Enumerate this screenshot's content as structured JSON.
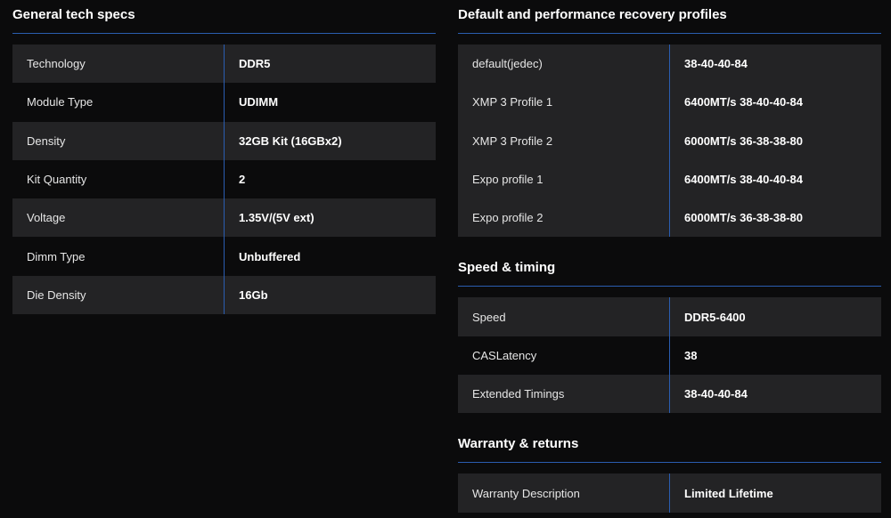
{
  "sections": {
    "general": {
      "title": "General tech specs",
      "rows": [
        {
          "label": "Technology",
          "value": "DDR5"
        },
        {
          "label": "Module Type",
          "value": "UDIMM"
        },
        {
          "label": "Density",
          "value": "32GB Kit (16GBx2)"
        },
        {
          "label": "Kit Quantity",
          "value": "2"
        },
        {
          "label": "Voltage",
          "value": "1.35V/(5V ext)"
        },
        {
          "label": "Dimm Type",
          "value": "Unbuffered"
        },
        {
          "label": "Die Density",
          "value": "16Gb"
        }
      ]
    },
    "profiles": {
      "title": "Default and performance recovery profiles",
      "rows": [
        {
          "label": "default(jedec)",
          "value": "38-40-40-84"
        },
        {
          "label": "XMP 3 Profile 1",
          "value": "6400MT/s 38-40-40-84"
        },
        {
          "label": "XMP 3 Profile 2",
          "value": "6000MT/s 36-38-38-80"
        },
        {
          "label": "Expo profile 1",
          "value": "6400MT/s 38-40-40-84"
        },
        {
          "label": "Expo profile 2",
          "value": "6000MT/s 36-38-38-80"
        }
      ]
    },
    "speed": {
      "title": "Speed & timing",
      "rows": [
        {
          "label": "Speed",
          "value": "DDR5-6400"
        },
        {
          "label": "CASLatency",
          "value": "38"
        },
        {
          "label": "Extended Timings",
          "value": "38-40-40-84"
        }
      ]
    },
    "warranty": {
      "title": "Warranty & returns",
      "rows": [
        {
          "label": "Warranty Description",
          "value": "Limited Lifetime"
        }
      ]
    }
  },
  "colors": {
    "background": "#0b0b0c",
    "row_stripe": "#232325",
    "divider_blue": "#2a5db0",
    "text": "#ffffff"
  }
}
